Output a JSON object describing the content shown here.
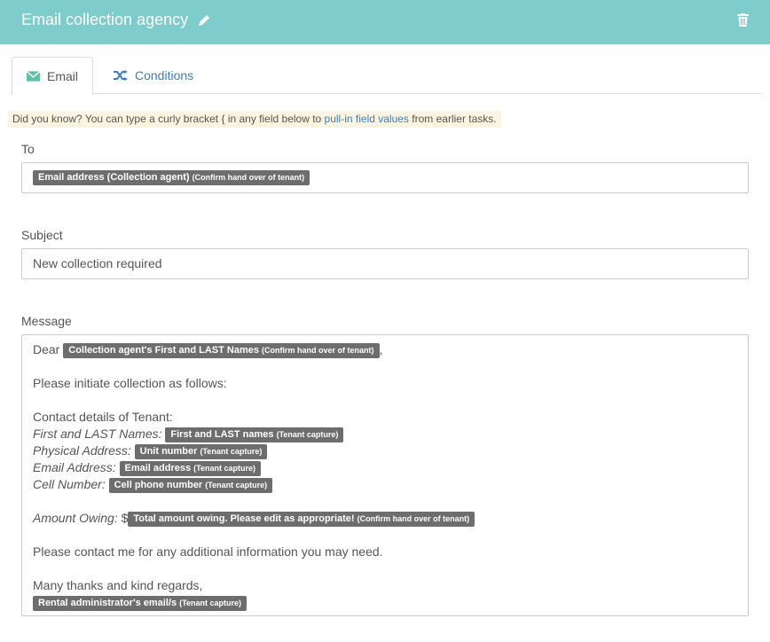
{
  "header": {
    "title": "Email collection agency",
    "icons": {
      "edit": "pencil-icon",
      "delete": "trash-icon"
    }
  },
  "tabs": [
    {
      "label": "Email",
      "icon": "envelope-icon",
      "active": true
    },
    {
      "label": "Conditions",
      "icon": "shuffle-icon",
      "active": false
    }
  ],
  "tip": {
    "before": "Did you know? You can type a curly bracket { in any field below to ",
    "link": "pull-in field values",
    "after": " from earlier tasks."
  },
  "to": {
    "label": "To",
    "tag": {
      "name": "Email address (Collection agent)",
      "source": "(Confirm hand over of tenant)"
    }
  },
  "subject": {
    "label": "Subject",
    "value": "New collection required"
  },
  "message": {
    "label": "Message",
    "dear": "Dear",
    "dear_tag": {
      "name": "Collection agent's First and LAST Names",
      "source": "(Confirm hand over of tenant)"
    },
    "dear_suffix": ",",
    "line1": "Please initiate collection as follows:",
    "contact_heading": "Contact details of Tenant:",
    "names_label": "First and LAST Names:",
    "names_tag": {
      "name": "First and LAST names",
      "source": "(Tenant capture)"
    },
    "address_label": "Physical Address:",
    "address_tag": {
      "name": "Unit number",
      "source": "(Tenant capture)"
    },
    "email_label": "Email Address:",
    "email_tag": {
      "name": "Email address",
      "source": "(Tenant capture)"
    },
    "cell_label": "Cell Number:",
    "cell_tag": {
      "name": "Cell phone number",
      "source": "(Tenant capture)"
    },
    "owing_label": "Amount Owing:",
    "owing_currency": "$",
    "owing_tag": {
      "name": "Total amount owing. Please edit as appropriate!",
      "source": "(Confirm hand over of tenant)"
    },
    "line2": "Please contact me for any additional information you may need.",
    "line3": "Many thanks and kind regards,",
    "sig_tag": {
      "name": "Rental administrator's email/s",
      "source": "(Tenant capture)"
    }
  },
  "colors": {
    "header": "#7ecccc",
    "link": "#3a7fc1",
    "tag": "#6d6d6d",
    "tip_bg": "#fbf5df"
  }
}
